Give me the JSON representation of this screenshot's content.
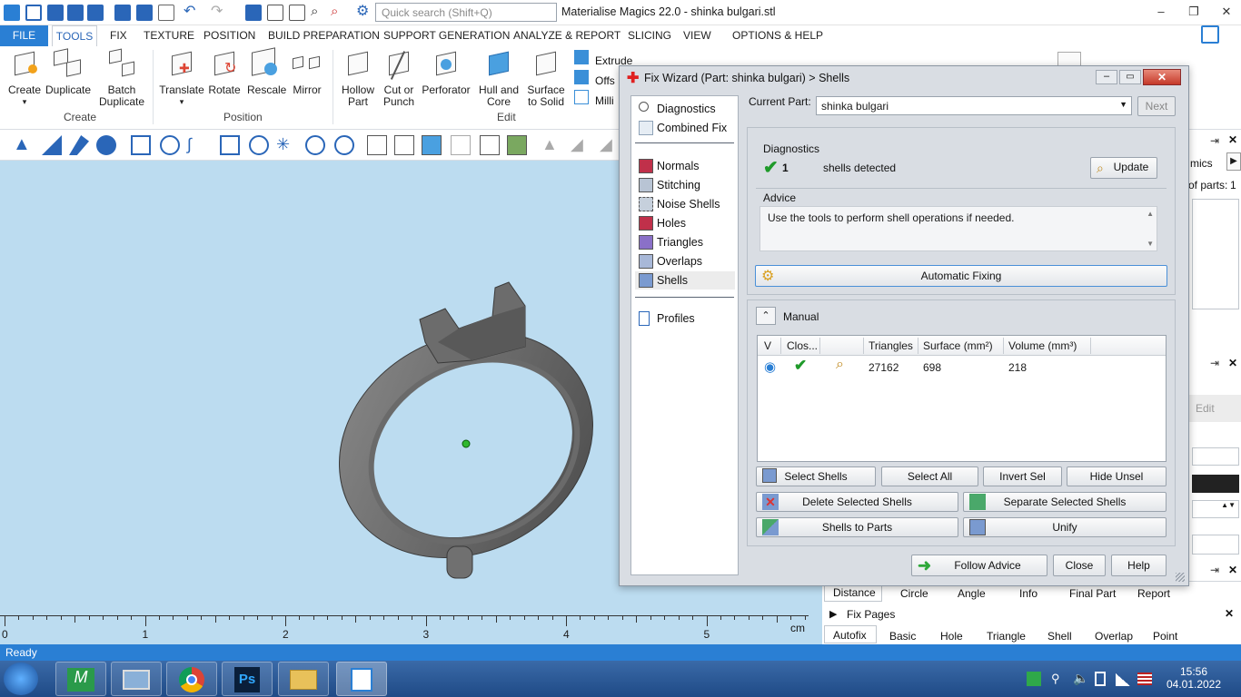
{
  "titlebar": {
    "search_placeholder": "Quick search (Shift+Q)",
    "app_title": "Materialise Magics 22.0 - shinka bulgari.stl"
  },
  "menubar": {
    "file": "FILE",
    "items": [
      "TOOLS",
      "FIX",
      "TEXTURE",
      "POSITION",
      "BUILD PREPARATION",
      "SUPPORT GENERATION",
      "ANALYZE & REPORT",
      "SLICING",
      "VIEW",
      "OPTIONS & HELP"
    ]
  },
  "ribbon": {
    "create": "Create",
    "duplicate": "Duplicate",
    "batch_duplicate_1": "Batch",
    "batch_duplicate_2": "Duplicate",
    "group_create": "Create",
    "translate": "Translate",
    "rotate": "Rotate",
    "rescale": "Rescale",
    "mirror": "Mirror",
    "group_position": "Position",
    "hollow_1": "Hollow",
    "hollow_2": "Part",
    "cut_1": "Cut or",
    "cut_2": "Punch",
    "perforator": "Perforator",
    "hull_1": "Hull and",
    "hull_2": "Core",
    "surface_1": "Surface",
    "surface_2": "to Solid",
    "extrude": "Extrude",
    "offset": "Offs",
    "milling": "Milli",
    "group_edit": "Edit"
  },
  "ruler": {
    "ticks": [
      "0",
      "1",
      "2",
      "3",
      "4",
      "5"
    ],
    "unit": "cm"
  },
  "rightpanel": {
    "mics": "mics",
    "parts": "of parts:",
    "parts_count": "1",
    "edit": "Edit"
  },
  "bottom": {
    "measure_tabs": [
      "Distance",
      "Circle",
      "Angle",
      "Info",
      "Final Part",
      "Report"
    ],
    "fix_pages": "Fix Pages",
    "fix_tabs": [
      "Autofix",
      "Basic",
      "Hole",
      "Triangle",
      "Shell",
      "Overlap",
      "Point"
    ]
  },
  "status": "Ready",
  "clock": {
    "time": "15:56",
    "date": "04.01.2022"
  },
  "dialog": {
    "title": "Fix Wizard (Part: shinka bulgari) > Shells",
    "nav": [
      {
        "label": "Diagnostics",
        "icon": "magnifier-icon"
      },
      {
        "label": "Combined Fix",
        "icon": "cube-icon"
      },
      {
        "label": "Normals",
        "icon": "normals-icon"
      },
      {
        "label": "Stitching",
        "icon": "stitching-icon"
      },
      {
        "label": "Noise Shells",
        "icon": "noise-shells-icon"
      },
      {
        "label": "Holes",
        "icon": "holes-icon"
      },
      {
        "label": "Triangles",
        "icon": "triangles-icon"
      },
      {
        "label": "Overlaps",
        "icon": "overlaps-icon"
      },
      {
        "label": "Shells",
        "icon": "shells-icon"
      },
      {
        "label": "Profiles",
        "icon": "document-icon"
      }
    ],
    "current_part_label": "Current Part:",
    "current_part": "shinka bulgari",
    "next": "Next",
    "diagnostics_title": "Diagnostics",
    "diag_count": "1",
    "diag_text": "shells detected",
    "update": "Update",
    "advice_title": "Advice",
    "advice_text": "Use the tools to perform shell operations if needed.",
    "automatic_fixing": "Automatic Fixing",
    "manual": "Manual",
    "table_headers": [
      "V",
      "Clos...",
      "",
      "Triangles",
      "Surface (mm²)",
      "Volume (mm³)"
    ],
    "table_row": {
      "triangles": "27162",
      "surface": "698",
      "volume": "218"
    },
    "select_shells": "Select Shells",
    "select_all": "Select All",
    "invert_sel": "Invert Sel",
    "hide_unsel": "Hide Unsel",
    "delete_selected": "Delete Selected Shells",
    "separate_selected": "Separate Selected Shells",
    "shells_to_parts": "Shells to Parts",
    "unify": "Unify",
    "follow_advice": "Follow Advice",
    "close": "Close",
    "help": "Help"
  },
  "colors": {
    "accent": "#2a7fd4",
    "viewport": "#bcdcf0",
    "check": "#1f9a2a"
  }
}
